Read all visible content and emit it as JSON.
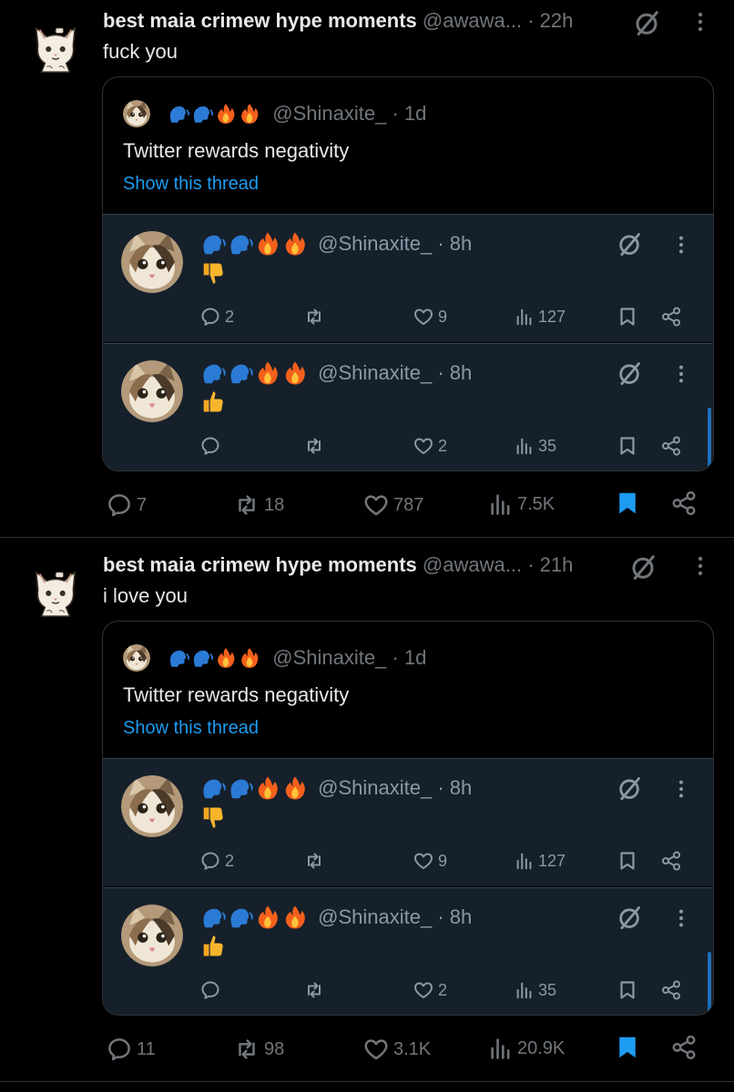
{
  "colors": {
    "background": "#000000",
    "nested": "#15202b",
    "accent": "#1d9bf0",
    "muted": "#71767b",
    "bookmark_active": "#1d9bf0"
  },
  "tweets": [
    {
      "name": "best maia crimew hype moments",
      "handle": "@awawa...",
      "time": "· 22h",
      "text": "fuck you",
      "quote": {
        "handle": "@Shinaxite_",
        "time": "· 1d",
        "text": "Twitter rewards negativity",
        "show_thread": "Show this thread",
        "replies": [
          {
            "handle": "@Shinaxite_",
            "time": "· 8h",
            "emoji": "thumbs-down",
            "replies": "2",
            "retweets": "",
            "likes": "9",
            "views": "127"
          },
          {
            "handle": "@Shinaxite_",
            "time": "· 8h",
            "emoji": "thumbs-up",
            "replies": "",
            "retweets": "",
            "likes": "2",
            "views": "35"
          }
        ]
      },
      "stats": {
        "replies": "7",
        "retweets": "18",
        "likes": "787",
        "views": "7.5K"
      }
    },
    {
      "name": "best maia crimew hype moments",
      "handle": "@awawa...",
      "time": "· 21h",
      "text": "i love you",
      "quote": {
        "handle": "@Shinaxite_",
        "time": "· 1d",
        "text": "Twitter rewards negativity",
        "show_thread": "Show this thread",
        "replies": [
          {
            "handle": "@Shinaxite_",
            "time": "· 8h",
            "emoji": "thumbs-down",
            "replies": "2",
            "retweets": "",
            "likes": "9",
            "views": "127"
          },
          {
            "handle": "@Shinaxite_",
            "time": "· 8h",
            "emoji": "thumbs-up",
            "replies": "",
            "retweets": "",
            "likes": "2",
            "views": "35"
          }
        ]
      },
      "stats": {
        "replies": "11",
        "retweets": "98",
        "likes": "3.1K",
        "views": "20.9K"
      }
    }
  ]
}
